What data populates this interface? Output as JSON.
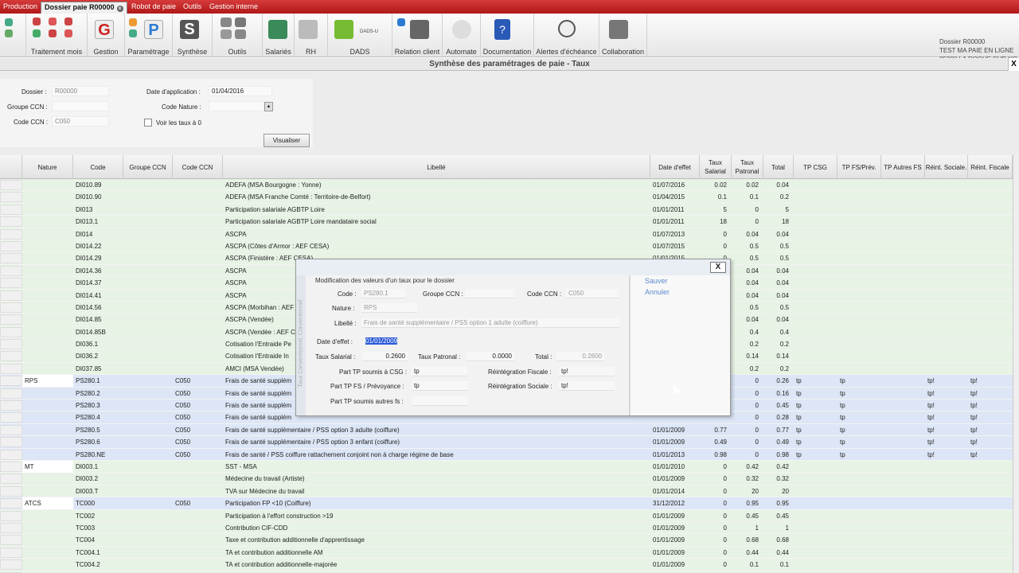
{
  "tabs": [
    "Production",
    "Dossier paie R00000",
    "Robot de paie",
    "Outils",
    "Gestion interne"
  ],
  "ribbon_groups": [
    {
      "label": "Traitement mois",
      "icon": "calendar-icon"
    },
    {
      "label": "Gestion",
      "icon": "g-letter-icon"
    },
    {
      "label": "Paramétrage",
      "icon": "p-letter-icon"
    },
    {
      "label": "Synthèse",
      "icon": "s-letter-icon"
    },
    {
      "label": "Outils",
      "icon": "tools-icon"
    },
    {
      "label": "Salariés",
      "icon": "people-icon"
    },
    {
      "label": "RH",
      "icon": "hr-icon"
    },
    {
      "label": "DADS",
      "icon": "dads-icon"
    },
    {
      "label": "Relation client",
      "icon": "client-icon"
    },
    {
      "label": "Automate",
      "icon": "play-icon"
    },
    {
      "label": "Documentation",
      "icon": "help-book-icon"
    },
    {
      "label": "Alertes d'échéance",
      "icon": "clock-icon"
    },
    {
      "label": "Collaboration",
      "icon": "team-icon"
    }
  ],
  "ribbon_small": {
    "dads_u": "DADS-U"
  },
  "company": {
    "line1": "Dossier R00000",
    "line2": "TEST MA PAIE EN LIGNE",
    "line3": "85000 LA ROCHE SUR YO"
  },
  "window": {
    "title": "Synthèse des paramétrages de paie - Taux",
    "close": "X"
  },
  "filter": {
    "dossier_label": "Dossier :",
    "dossier_value": "R00000",
    "groupe_ccn_label": "Groupe CCN :",
    "groupe_ccn_value": "",
    "code_ccn_label": "Code CCN :",
    "code_ccn_value": "C050",
    "date_app_label": "Date d'application :",
    "date_app_value": "01/04/2016",
    "code_nature_label": "Code Nature :",
    "code_nature_value": "",
    "voir_taux_label": "Voir les taux à 0",
    "visualiser": "Visualiser"
  },
  "columns": [
    "Nature",
    "Code",
    "Groupe CCN",
    "Code CCN",
    "Libellé",
    "Date d'effet",
    "Taux Salarial",
    "Taux Patronal",
    "Total",
    "TP CSG",
    "TP FS/Prév.",
    "TP Autres FS",
    "Réint. Sociale.",
    "Réint. Fiscale"
  ],
  "rows": [
    {
      "nature": "",
      "code": "DI010.89",
      "ccn": "",
      "lib": "ADEFA (MSA Bourgogne : Yonne)",
      "date": "01/07/2016",
      "ts": "0.02",
      "tp": "0.02",
      "tot": "0.04",
      "sel": false
    },
    {
      "nature": "",
      "code": "DI010.90",
      "ccn": "",
      "lib": "ADEFA (MSA Franche Comté : Territoire-de-Belfort)",
      "date": "01/04/2015",
      "ts": "0.1",
      "tp": "0.1",
      "tot": "0.2",
      "sel": false
    },
    {
      "nature": "",
      "code": "DI013",
      "ccn": "",
      "lib": "Participation salariale AGBTP Loire",
      "date": "01/01/2011",
      "ts": "5",
      "tp": "0",
      "tot": "5",
      "sel": false
    },
    {
      "nature": "",
      "code": "DI013.1",
      "ccn": "",
      "lib": "Participation salariale AGBTP Loire mandataire social",
      "date": "01/01/2011",
      "ts": "18",
      "tp": "0",
      "tot": "18",
      "sel": false
    },
    {
      "nature": "",
      "code": "DI014",
      "ccn": "",
      "lib": "ASCPA",
      "date": "01/07/2013",
      "ts": "0",
      "tp": "0.04",
      "tot": "0.04",
      "sel": false
    },
    {
      "nature": "",
      "code": "DI014.22",
      "ccn": "",
      "lib": "ASCPA (Côtes d'Armor : AEF CESA)",
      "date": "01/07/2015",
      "ts": "0",
      "tp": "0.5",
      "tot": "0.5",
      "sel": false
    },
    {
      "nature": "",
      "code": "DI014.29",
      "ccn": "",
      "lib": "ASCPA (Finistère : AEF CESA)",
      "date": "01/01/2015",
      "ts": "0",
      "tp": "0.5",
      "tot": "0.5",
      "sel": false
    },
    {
      "nature": "",
      "code": "DI014.36",
      "ccn": "",
      "lib": "ASCPA",
      "date": "",
      "ts": "",
      "tp": "0.04",
      "tot": "0.04",
      "sel": false
    },
    {
      "nature": "",
      "code": "DI014.37",
      "ccn": "",
      "lib": "ASCPA",
      "date": "",
      "ts": "",
      "tp": "0.04",
      "tot": "0.04",
      "sel": false
    },
    {
      "nature": "",
      "code": "DI014.41",
      "ccn": "",
      "lib": "ASCPA",
      "date": "",
      "ts": "",
      "tp": "0.04",
      "tot": "0.04",
      "sel": false
    },
    {
      "nature": "",
      "code": "DI014.56",
      "ccn": "",
      "lib": "ASCPA (Morbihan : AEF C",
      "date": "",
      "ts": "",
      "tp": "0.5",
      "tot": "0.5",
      "sel": false
    },
    {
      "nature": "",
      "code": "DI014.85",
      "ccn": "",
      "lib": "ASCPA (Vendée)",
      "date": "",
      "ts": "",
      "tp": "0.04",
      "tot": "0.04",
      "sel": false
    },
    {
      "nature": "",
      "code": "DI014.85B",
      "ccn": "",
      "lib": "ASCPA (Vendée : AEF CE",
      "date": "",
      "ts": "",
      "tp": "0.4",
      "tot": "0.4",
      "sel": false
    },
    {
      "nature": "",
      "code": "DI036.1",
      "ccn": "",
      "lib": "Cotisation l'Entraide Pe",
      "date": "",
      "ts": "",
      "tp": "0.2",
      "tot": "0.2",
      "sel": false
    },
    {
      "nature": "",
      "code": "DI036.2",
      "ccn": "",
      "lib": "Cotisation l'Entraide In",
      "date": "",
      "ts": "",
      "tp": "0.14",
      "tot": "0.14",
      "sel": false
    },
    {
      "nature": "",
      "code": "DI037.85",
      "ccn": "",
      "lib": "AMCI (MSA Vendée)",
      "date": "",
      "ts": "",
      "tp": "0.2",
      "tot": "0.2",
      "sel": false
    },
    {
      "nature": "RPS",
      "code": "PS280.1",
      "ccn": "C050",
      "lib": "Frais de santé supplém",
      "date": "",
      "ts": "",
      "tp": "0",
      "tot": "0.26",
      "csg": "tp",
      "fs": "tp",
      "rs": "tp!",
      "rf": "tp!",
      "sel": true
    },
    {
      "nature": "",
      "code": "PS280.2",
      "ccn": "C050",
      "lib": "Frais de santé supplém",
      "date": "",
      "ts": "",
      "tp": "0",
      "tot": "0.16",
      "csg": "tp",
      "fs": "tp",
      "rs": "tp!",
      "rf": "tp!",
      "sel": true
    },
    {
      "nature": "",
      "code": "PS280.3",
      "ccn": "C050",
      "lib": "Frais de santé supplém",
      "date": "",
      "ts": "",
      "tp": "0",
      "tot": "0.45",
      "csg": "tp",
      "fs": "tp",
      "rs": "tp!",
      "rf": "tp!",
      "sel": true
    },
    {
      "nature": "",
      "code": "PS280.4",
      "ccn": "C050",
      "lib": "Frais de santé supplém",
      "date": "",
      "ts": "",
      "tp": "0",
      "tot": "0.28",
      "csg": "tp",
      "fs": "tp",
      "rs": "tp!",
      "rf": "tp!",
      "sel": true
    },
    {
      "nature": "",
      "code": "PS280.5",
      "ccn": "C050",
      "lib": "Frais de santé supplémentaire / PSS option 3 adulte (coiffure)",
      "date": "01/01/2009",
      "ts": "0.77",
      "tp": "0",
      "tot": "0.77",
      "csg": "tp",
      "fs": "tp",
      "rs": "tp!",
      "rf": "tp!",
      "sel": true
    },
    {
      "nature": "",
      "code": "PS280.6",
      "ccn": "C050",
      "lib": "Frais de santé supplémentaire / PSS option 3 enfant (coiffure)",
      "date": "01/01/2009",
      "ts": "0.49",
      "tp": "0",
      "tot": "0.49",
      "csg": "tp",
      "fs": "tp",
      "rs": "tp!",
      "rf": "tp!",
      "sel": true
    },
    {
      "nature": "",
      "code": "PS280.NE",
      "ccn": "C050",
      "lib": "Frais de santé / PSS coiffure rattachement conjoint non à charge régime de base",
      "date": "01/01/2013",
      "ts": "0.98",
      "tp": "0",
      "tot": "0.98",
      "csg": "tp",
      "fs": "tp",
      "rs": "tp!",
      "rf": "tp!",
      "sel": true
    },
    {
      "nature": "MT",
      "code": "DI003.1",
      "ccn": "",
      "lib": "SST - MSA",
      "date": "01/01/2010",
      "ts": "0",
      "tp": "0.42",
      "tot": "0.42",
      "sel": false
    },
    {
      "nature": "",
      "code": "DI003.2",
      "ccn": "",
      "lib": "Médecine du travail (Artiste)",
      "date": "01/01/2009",
      "ts": "0",
      "tp": "0.32",
      "tot": "0.32",
      "sel": false
    },
    {
      "nature": "",
      "code": "DI003.T",
      "ccn": "",
      "lib": "TVA sur Médecine du travail",
      "date": "01/01/2014",
      "ts": "0",
      "tp": "20",
      "tot": "20",
      "sel": false
    },
    {
      "nature": "ATCS",
      "code": "TC000",
      "ccn": "C050",
      "lib": "Participation FP <10 (Coiffure)",
      "date": "31/12/2012",
      "ts": "0",
      "tp": "0.95",
      "tot": "0.95",
      "sel": true
    },
    {
      "nature": "",
      "code": "TC002",
      "ccn": "",
      "lib": "Participation à l'effort construction >19",
      "date": "01/01/2009",
      "ts": "0",
      "tp": "0.45",
      "tot": "0.45",
      "sel": false
    },
    {
      "nature": "",
      "code": "TC003",
      "ccn": "",
      "lib": "Contribution CIF-CDD",
      "date": "01/01/2009",
      "ts": "0",
      "tp": "1",
      "tot": "1",
      "sel": false
    },
    {
      "nature": "",
      "code": "TC004",
      "ccn": "",
      "lib": "Taxe et contribution additionnelle d'apprentissage",
      "date": "01/01/2009",
      "ts": "0",
      "tp": "0.68",
      "tot": "0.68",
      "sel": false
    },
    {
      "nature": "",
      "code": "TC004.1",
      "ccn": "",
      "lib": "TA et contribution additionnelle AM",
      "date": "01/01/2009",
      "ts": "0",
      "tp": "0.44",
      "tot": "0.44",
      "sel": false
    },
    {
      "nature": "",
      "code": "TC004.2",
      "ccn": "",
      "lib": "TA et contribution additionnelle-majorée",
      "date": "01/01/2009",
      "ts": "0",
      "tp": "0.1",
      "tot": "0.1",
      "sel": false
    },
    {
      "nature": "",
      "code": "TC004.3",
      "ccn": "",
      "lib": "TA et contribution additionnelle-majorée AM",
      "date": "01/01/2009",
      "ts": "0",
      "tp": "0.052",
      "tot": "0.052",
      "sel": false
    }
  ],
  "modal": {
    "close": "X",
    "heading": "Modification des valeurs d'un taux pour le dossier",
    "vertical_label": "Taux Conventionnel, Conventionnel",
    "code_label": "Code :",
    "code_value": "PS280.1",
    "groupe_ccn_label": "Groupe CCN :",
    "groupe_ccn_value": "",
    "code_ccn_label": "Code CCN :",
    "code_ccn_value": "C050",
    "nature_label": "Nature :",
    "nature_value": "RPS",
    "libelle_label": "Libellé :",
    "libelle_value": "Frais de santé supplémentaire / PSS option 1 adulte (coiffure)",
    "date_effet_label": "Date d'effet :",
    "date_effet_value": "01/01/2009",
    "taux_salarial_label": "Taux Salarial :",
    "taux_salarial_value": "0.2600",
    "taux_patronal_label": "Taux Patronal :",
    "taux_patronal_value": "0.0000",
    "total_label": "Total :",
    "total_value": "0.2600",
    "tp_csg_label": "Part TP soumis à CSG :",
    "tp_csg_value": "tp",
    "tp_fs_label": "Part TP FS / Prévoyance :",
    "tp_fs_value": "tp",
    "tp_autres_label": "Part TP soumis autres fs :",
    "tp_autres_value": "",
    "reint_fiscale_label": "Réintégration Fiscale :",
    "reint_fiscale_value": "tp!",
    "reint_sociale_label": "Réintégration Sociale :",
    "reint_sociale_value": "tp!",
    "sauver": "Sauver",
    "annuler": "Annuler"
  }
}
